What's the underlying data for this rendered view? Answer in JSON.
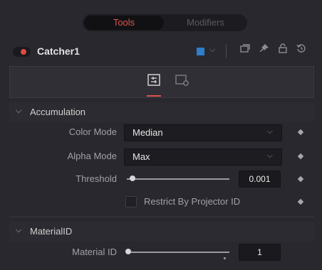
{
  "tabs": {
    "tools": "Tools",
    "modifiers": "Modifiers"
  },
  "node": {
    "title": "Catcher1",
    "color": "#2c7fc8",
    "header_icons": [
      "version-icon",
      "pin-icon",
      "lock-icon",
      "reset-icon"
    ]
  },
  "panel_tabs": [
    "controls-tab-icon",
    "settings-tab-icon"
  ],
  "sections": {
    "accumulation": {
      "title": "Accumulation",
      "color_mode": {
        "label": "Color Mode",
        "value": "Median"
      },
      "alpha_mode": {
        "label": "Alpha Mode",
        "value": "Max"
      },
      "threshold": {
        "label": "Threshold",
        "value": "0.001"
      },
      "restrict": {
        "label": "Restrict By Projector ID",
        "checked": false
      }
    },
    "material": {
      "title": "MaterialID",
      "material_id": {
        "label": "Material ID",
        "value": "1"
      }
    }
  }
}
